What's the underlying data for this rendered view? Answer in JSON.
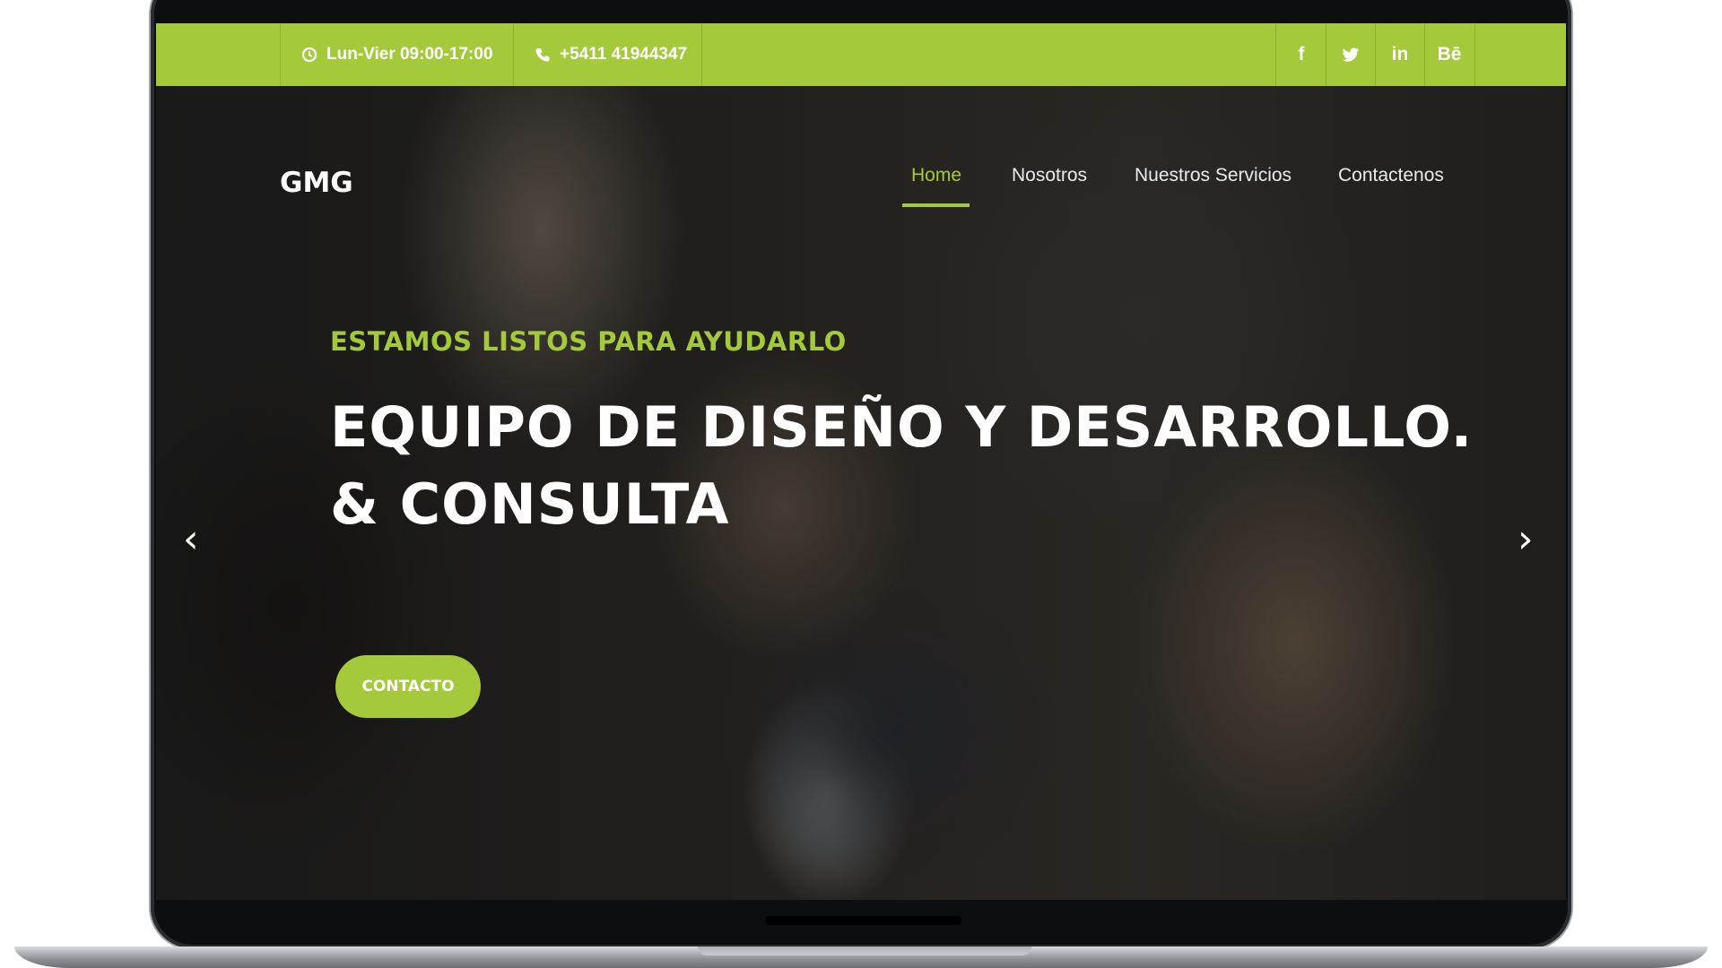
{
  "topbar": {
    "hours": "Lun-Vier 09:00-17:00",
    "phone": "+5411 41944347",
    "hours_icon": "clock-icon",
    "phone_icon": "phone-icon",
    "social": [
      {
        "label": "f",
        "icon": "facebook-icon"
      },
      {
        "label": "🐦",
        "icon": "twitter-icon"
      },
      {
        "label": "in",
        "icon": "linkedin-icon"
      },
      {
        "label": "Bē",
        "icon": "behance-icon"
      }
    ],
    "color": "#a4c93a"
  },
  "header": {
    "logo": "GMG",
    "nav": [
      {
        "label": "Home",
        "active": true
      },
      {
        "label": "Nosotros"
      },
      {
        "label": "Nuestros Servicios"
      },
      {
        "label": "Contactenos"
      }
    ]
  },
  "hero": {
    "subtitle": "ESTAMOS LISTOS PARA AYUDARLO",
    "headline_line1": "EQUIPO DE DISEÑO Y DESARROLLO.",
    "headline_line2": "& CONSULTA",
    "cta": "CONTACTO",
    "prev_arrow": "‹",
    "next_arrow": "›"
  },
  "colors": {
    "accent": "#a4c93a",
    "text": "#ffffff"
  }
}
